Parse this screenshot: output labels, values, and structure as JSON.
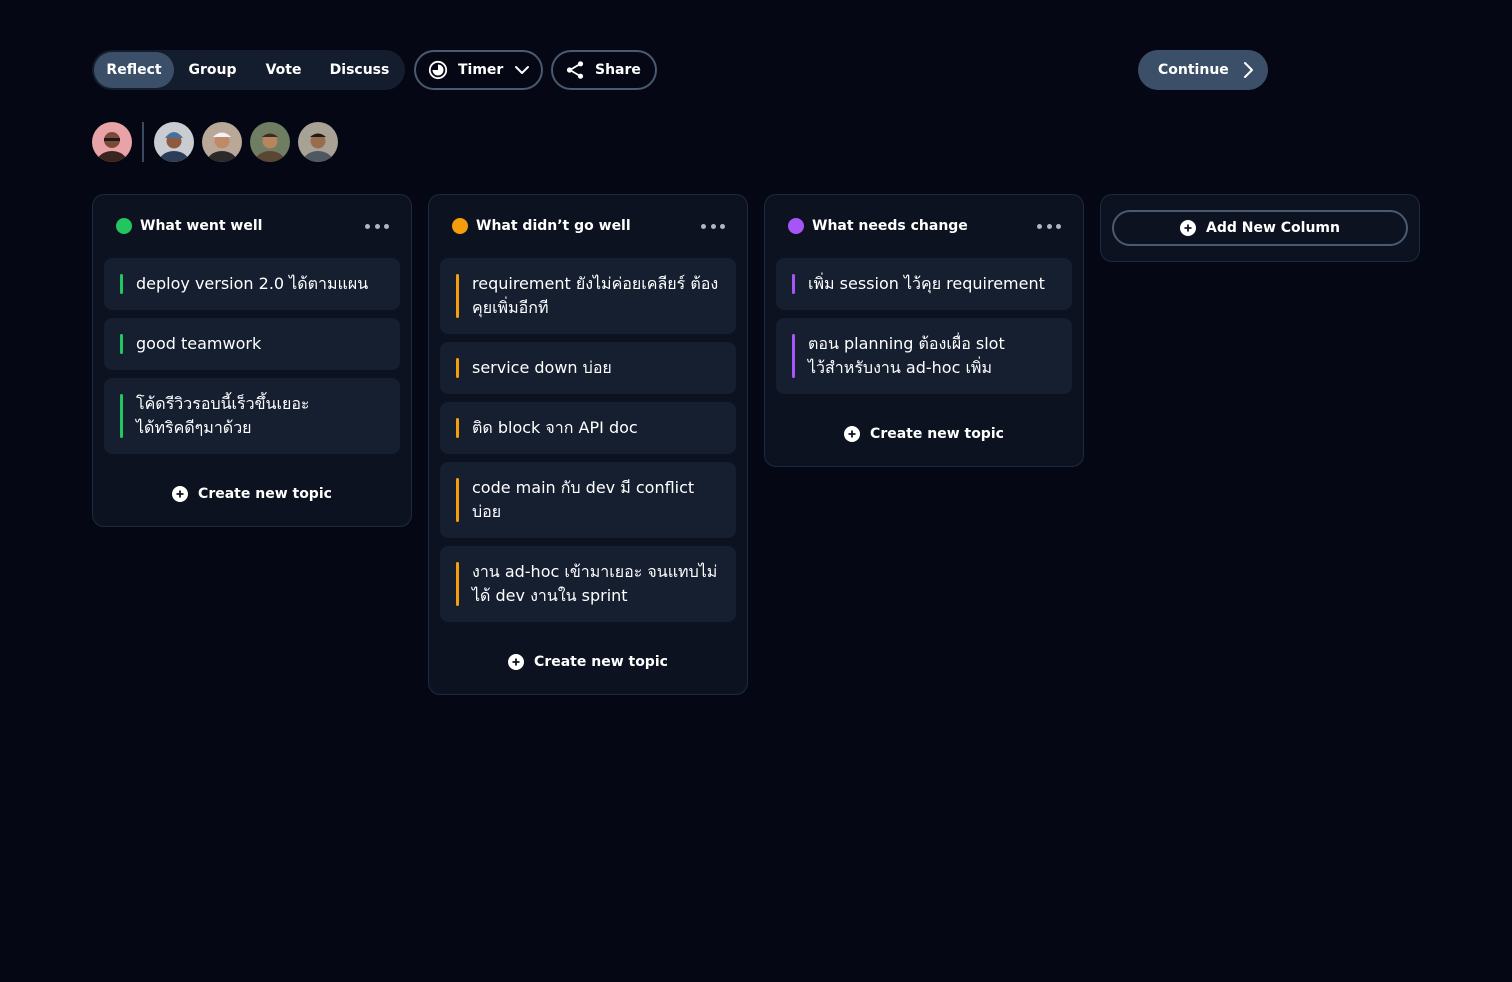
{
  "toolbar": {
    "stages": [
      {
        "label": "Reflect",
        "active": true
      },
      {
        "label": "Group",
        "active": false
      },
      {
        "label": "Vote",
        "active": false
      },
      {
        "label": "Discuss",
        "active": false
      }
    ],
    "timer_label": "Timer",
    "share_label": "Share",
    "continue_label": "Continue"
  },
  "avatars": [
    {
      "name": "current-user-avatar"
    },
    {
      "name": "participant-avatar-1"
    },
    {
      "name": "participant-avatar-2"
    },
    {
      "name": "participant-avatar-3"
    },
    {
      "name": "participant-avatar-4"
    }
  ],
  "columns": [
    {
      "title": "What went well",
      "color": "#22c55e",
      "cards": [
        "deploy version 2.0 ได้ตามแผน",
        "good teamwork",
        "โค้ดรีวิวรอบนี้เร็วขึ้นเยอะ ได้ทริคดีๆมาด้วย"
      ],
      "create_label": "Create new topic"
    },
    {
      "title": "What didn’t go well",
      "color": "#f59e0b",
      "cards": [
        "requirement ยังไม่ค่อยเคลียร์ ต้องคุยเพิ่มอีกที",
        "service down บ่อย",
        "ติด block จาก API doc",
        "code main กับ dev มี conflict บ่อย",
        "งาน ad-hoc เข้ามาเยอะ จนแทบไม่ได้ dev งานใน sprint"
      ],
      "create_label": "Create new topic"
    },
    {
      "title": "What needs change",
      "color": "#a855f7",
      "cards": [
        "เพิ่ม session ไว้คุย requirement",
        "ตอน planning ต้องเผื่อ slot ไว้สำหรับงาน ad-hoc เพิ่ม"
      ],
      "create_label": "Create new topic"
    }
  ],
  "add_column_label": "Add New Column"
}
